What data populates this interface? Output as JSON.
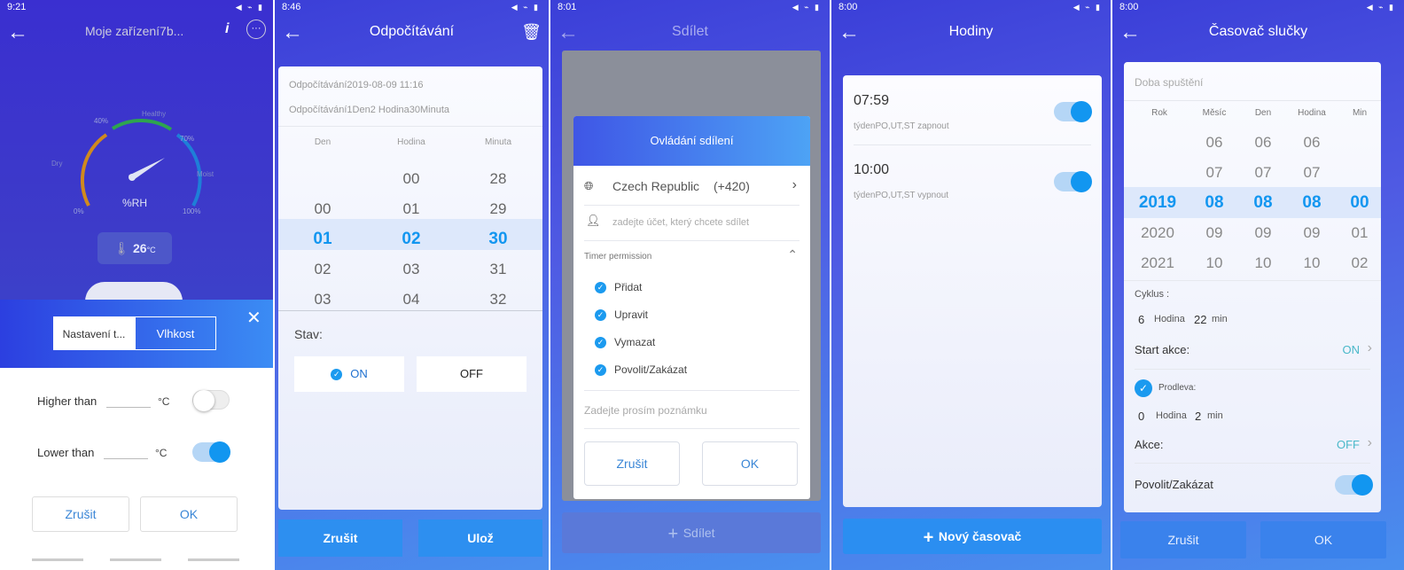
{
  "p1": {
    "time": "9:21",
    "title": "Moje zařízení7b...",
    "gauge_label": "%RH",
    "gauge_ticks": [
      "0%",
      "40%",
      "70%",
      "100%"
    ],
    "gauge_words": [
      "Dry",
      "Healthy",
      "Moist"
    ],
    "temp": "26",
    "temp_unit": "°C",
    "tab_left": "Nastavení t...",
    "tab_right": "Vlhkost",
    "row1_label": "Higher than",
    "row1_unit": "°C",
    "row2_label": "Lower than",
    "row2_unit": "°C",
    "cancel": "Zrušit",
    "ok": "OK"
  },
  "p2": {
    "time": "8:46",
    "title": "Odpočítávání",
    "line1": "Odpočítávání2019-08-09 11:16",
    "line2": "Odpočítávání1Den2 Hodina30Minuta",
    "col_den": "Den",
    "col_hodina": "Hodina",
    "col_minuta": "Minuta",
    "den": [
      "",
      "00",
      "01",
      "02",
      "03"
    ],
    "hodina": [
      "00",
      "01",
      "02",
      "03",
      "04"
    ],
    "minuta": [
      "28",
      "29",
      "30",
      "31",
      "32"
    ],
    "stav": "Stav:",
    "on": "ON",
    "off": "OFF",
    "cancel": "Zrušit",
    "save": "Ulož"
  },
  "p3": {
    "time": "8:01",
    "title": "Sdílet",
    "dialog_title": "Ovládání sdílení",
    "country": "Czech Republic",
    "code": "(+420)",
    "account_placeholder": "zadejte účet, který chcete sdílet",
    "perm_header": "Timer permission",
    "perms": [
      "Přidat",
      "Upravit",
      "Vymazat",
      "Povolit/Zakázat"
    ],
    "note_placeholder": "Zadejte prosím poznámku",
    "cancel": "Zrušit",
    "ok": "OK",
    "share_button": "Sdílet"
  },
  "p4": {
    "time": "8:00",
    "title": "Hodiny",
    "timers": [
      {
        "time": "07:59",
        "desc": "týdenPO,UT,ST zapnout"
      },
      {
        "time": "10:00",
        "desc": "týdenPO,UT,ST vypnout"
      }
    ],
    "new_timer": "Nový časovač"
  },
  "p5": {
    "time": "8:00",
    "title": "Časovač slučky",
    "start_time": "Doba spuštění",
    "heads": [
      "Rok",
      "Měsíc",
      "Den",
      "Hodina",
      "Min"
    ],
    "rok": [
      "",
      "",
      "2019",
      "2020",
      "2021"
    ],
    "mesic": [
      "06",
      "07",
      "08",
      "09",
      "10"
    ],
    "den": [
      "06",
      "07",
      "08",
      "09",
      "10"
    ],
    "hodina": [
      "06",
      "07",
      "08",
      "09",
      "10"
    ],
    "min": [
      "",
      "",
      "00",
      "01",
      "02"
    ],
    "cyklus": "Cyklus :",
    "cyc_h": "6",
    "hodina_label": "Hodina",
    "cyc_m": "22",
    "min_label": "min",
    "start_akce": "Start akce:",
    "start_akce_val": "ON",
    "prodleva": "Prodleva:",
    "del_h": "0",
    "del_m": "2",
    "akce": "Akce:",
    "akce_val": "OFF",
    "povolit": "Povolit/Zakázat",
    "cancel": "Zrušit",
    "ok": "OK"
  },
  "colors": {
    "accent": "#1296f0",
    "gradient_start": "#3b3fd8",
    "gradient_end": "#4a8fee"
  }
}
